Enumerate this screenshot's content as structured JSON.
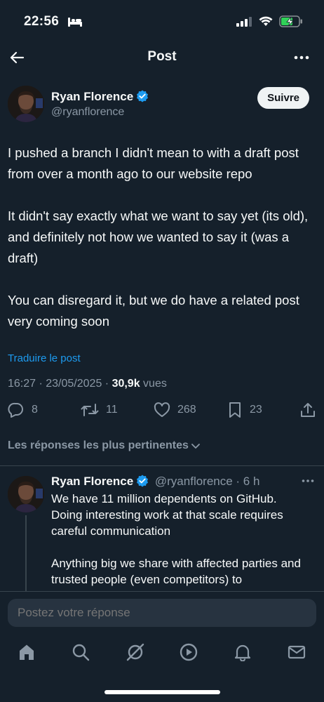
{
  "status": {
    "time": "22:56",
    "battery_color": "#30d158"
  },
  "nav": {
    "title": "Post"
  },
  "post": {
    "author_name": "Ryan Florence",
    "author_handle": "@ryanflorence",
    "follow_label": "Suivre",
    "paragraphs": [
      "I pushed a branch I didn't mean to with a draft post from over a month ago to our website repo",
      "It didn't say exactly what we want to say yet (its old), and definitely not how we wanted to say it (was a draft)",
      "You can disregard it, but we do have a related post very coming soon"
    ],
    "translate_label": "Traduire le post",
    "timestamp": "16:27 · 23/05/2025 · ",
    "views_count": "30,9k",
    "views_label": " vues",
    "stats": {
      "replies": "8",
      "reposts": "11",
      "likes": "268",
      "bookmarks": "23"
    }
  },
  "sort": {
    "label": "Les réponses les plus pertinentes"
  },
  "reply": {
    "author_name": "Ryan Florence",
    "author_handle": "@ryanflorence",
    "time": " · 6 h",
    "paragraphs": [
      "We have 11 million dependents on GitHub. Doing interesting work at that scale requires careful communication",
      "Anything big we share with affected parties and trusted people (even competitors) to"
    ]
  },
  "compose": {
    "placeholder": "Postez votre réponse"
  },
  "tabs": [
    "home-icon",
    "search-icon",
    "grok-icon",
    "video-icon",
    "notifications-icon",
    "messages-icon"
  ],
  "colors": {
    "background": "#15202b",
    "accent": "#1d9bf0",
    "muted": "#8b98a5",
    "divider": "#38444d"
  }
}
